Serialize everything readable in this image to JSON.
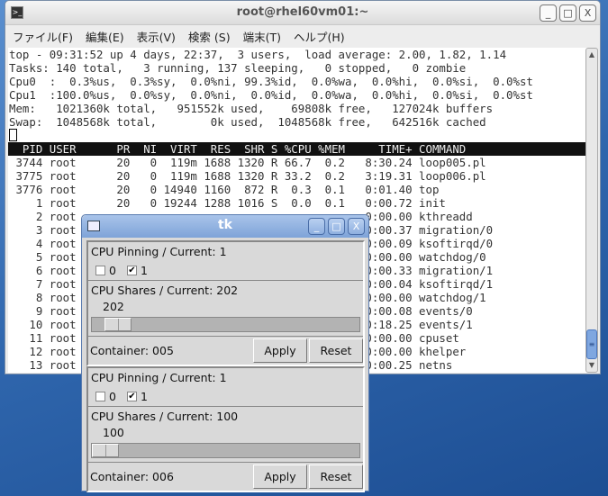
{
  "terminal": {
    "title": "root@rhel60vm01:~",
    "menu": [
      "ファイル(F)",
      "編集(E)",
      "表示(V)",
      "検索 (S)",
      "端末(T)",
      "ヘルプ(H)"
    ],
    "summary": [
      "top - 09:31:52 up 4 days, 22:37,  3 users,  load average: 2.00, 1.82, 1.14",
      "Tasks: 140 total,   3 running, 137 sleeping,   0 stopped,   0 zombie",
      "Cpu0  :  0.3%us,  0.3%sy,  0.0%ni, 99.3%id,  0.0%wa,  0.0%hi,  0.0%si,  0.0%st",
      "Cpu1  :100.0%us,  0.0%sy,  0.0%ni,  0.0%id,  0.0%wa,  0.0%hi,  0.0%si,  0.0%st",
      "Mem:   1021360k total,   951552k used,    69808k free,   127024k buffers",
      "Swap:  1048568k total,        0k used,  1048568k free,   642516k cached"
    ],
    "columns": [
      "PID",
      "USER",
      "PR",
      "NI",
      "VIRT",
      "RES",
      "SHR",
      "S",
      "%CPU",
      "%MEM",
      "TIME+",
      "COMMAND"
    ],
    "rows": [
      [
        "3744",
        "root",
        "20",
        "0",
        "119m",
        "1688",
        "1320",
        "R",
        "66.7",
        "0.2",
        "8:30.24",
        "loop005.pl"
      ],
      [
        "3775",
        "root",
        "20",
        "0",
        "119m",
        "1688",
        "1320",
        "R",
        "33.2",
        "0.2",
        "3:19.31",
        "loop006.pl"
      ],
      [
        "3776",
        "root",
        "20",
        "0",
        "14940",
        "1160",
        "872",
        "R",
        "0.3",
        "0.1",
        "0:01.40",
        "top"
      ],
      [
        "1",
        "root",
        "20",
        "0",
        "19244",
        "1288",
        "1016",
        "S",
        "0.0",
        "0.1",
        "0:00.72",
        "init"
      ],
      [
        "2",
        "root",
        "",
        "",
        "",
        "",
        "",
        "",
        "",
        "",
        "0:00.00",
        "kthreadd"
      ],
      [
        "3",
        "root",
        "",
        "",
        "",
        "",
        "",
        "",
        "",
        "",
        "0:00.37",
        "migration/0"
      ],
      [
        "4",
        "root",
        "",
        "",
        "",
        "",
        "",
        "",
        "",
        "",
        "0:00.09",
        "ksoftirqd/0"
      ],
      [
        "5",
        "root",
        "",
        "",
        "",
        "",
        "",
        "",
        "",
        "",
        "0:00.00",
        "watchdog/0"
      ],
      [
        "6",
        "root",
        "",
        "",
        "",
        "",
        "",
        "",
        "",
        "",
        "0:00.33",
        "migration/1"
      ],
      [
        "7",
        "root",
        "",
        "",
        "",
        "",
        "",
        "",
        "",
        "",
        "0:00.04",
        "ksoftirqd/1"
      ],
      [
        "8",
        "root",
        "",
        "",
        "",
        "",
        "",
        "",
        "",
        "",
        "0:00.00",
        "watchdog/1"
      ],
      [
        "9",
        "root",
        "",
        "",
        "",
        "",
        "",
        "",
        "",
        "",
        "0:00.08",
        "events/0"
      ],
      [
        "10",
        "root",
        "",
        "",
        "",
        "",
        "",
        "",
        "",
        "",
        "0:18.25",
        "events/1"
      ],
      [
        "11",
        "root",
        "",
        "",
        "",
        "",
        "",
        "",
        "",
        "",
        "0:00.00",
        "cpuset"
      ],
      [
        "12",
        "root",
        "",
        "",
        "",
        "",
        "",
        "",
        "",
        "",
        "0:00.00",
        "khelper"
      ],
      [
        "13",
        "root",
        "",
        "",
        "",
        "",
        "",
        "",
        "",
        "",
        "0:00.25",
        "netns"
      ]
    ]
  },
  "tk": {
    "title": "tk",
    "containers": [
      {
        "pinning_label": "CPU Pinning / Current: 1",
        "cpus": [
          {
            "label": "0",
            "checked": false
          },
          {
            "label": "1",
            "checked": true
          }
        ],
        "shares_label": "CPU Shares / Current: 202",
        "shares_value": "202",
        "slider_fraction": 0.05,
        "container_label": "Container: 005",
        "apply": "Apply",
        "reset": "Reset"
      },
      {
        "pinning_label": "CPU Pinning / Current: 1",
        "cpus": [
          {
            "label": "0",
            "checked": false
          },
          {
            "label": "1",
            "checked": true
          }
        ],
        "shares_label": "CPU Shares / Current: 100",
        "shares_value": "100",
        "slider_fraction": 0.0,
        "container_label": "Container: 006",
        "apply": "Apply",
        "reset": "Reset"
      }
    ]
  }
}
